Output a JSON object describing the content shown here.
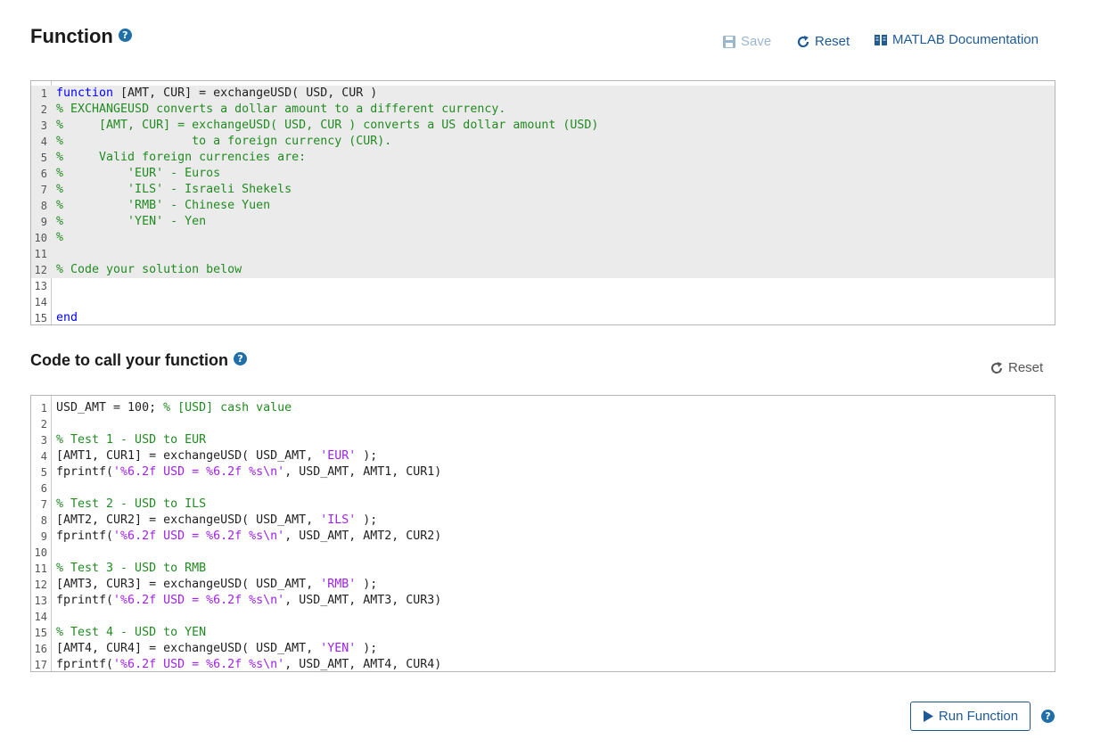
{
  "function_section": {
    "title": "Function",
    "toolbar": {
      "save_label": "Save",
      "reset_label": "Reset",
      "doc_label": "MATLAB Documentation"
    },
    "lines": [
      {
        "n": "1",
        "readonly": true,
        "parts": [
          [
            "kw",
            "function"
          ],
          [
            "tx",
            " [AMT, CUR] = exchangeUSD( USD, CUR )"
          ]
        ]
      },
      {
        "n": "2",
        "readonly": true,
        "parts": [
          [
            "cm",
            "% EXCHANGEUSD converts a dollar amount to a different currency."
          ]
        ]
      },
      {
        "n": "3",
        "readonly": true,
        "parts": [
          [
            "cm",
            "%     [AMT, CUR] = exchangeUSD( USD, CUR ) converts a US dollar amount (USD)"
          ]
        ]
      },
      {
        "n": "4",
        "readonly": true,
        "parts": [
          [
            "cm",
            "%                  to a foreign currency (CUR)."
          ]
        ]
      },
      {
        "n": "5",
        "readonly": true,
        "parts": [
          [
            "cm",
            "%     Valid foreign currencies are:"
          ]
        ]
      },
      {
        "n": "6",
        "readonly": true,
        "parts": [
          [
            "cm",
            "%         'EUR' - Euros"
          ]
        ]
      },
      {
        "n": "7",
        "readonly": true,
        "parts": [
          [
            "cm",
            "%         'ILS' - Israeli Shekels"
          ]
        ]
      },
      {
        "n": "8",
        "readonly": true,
        "parts": [
          [
            "cm",
            "%         'RMB' - Chinese Yuen"
          ]
        ]
      },
      {
        "n": "9",
        "readonly": true,
        "parts": [
          [
            "cm",
            "%         'YEN' - Yen"
          ]
        ]
      },
      {
        "n": "10",
        "readonly": true,
        "parts": [
          [
            "cm",
            "%"
          ]
        ]
      },
      {
        "n": "11",
        "readonly": true,
        "parts": []
      },
      {
        "n": "12",
        "readonly": true,
        "parts": [
          [
            "cm",
            "% Code your solution below"
          ]
        ]
      },
      {
        "n": "13",
        "readonly": false,
        "parts": []
      },
      {
        "n": "14",
        "readonly": false,
        "parts": []
      },
      {
        "n": "15",
        "readonly": false,
        "parts": [
          [
            "kw",
            "end"
          ]
        ]
      }
    ]
  },
  "call_section": {
    "title": "Code to call your function",
    "reset_label": "Reset",
    "lines": [
      {
        "n": "1",
        "parts": [
          [
            "tx",
            "USD_AMT = 100; "
          ],
          [
            "cm",
            "% [USD] cash value"
          ]
        ]
      },
      {
        "n": "2",
        "parts": []
      },
      {
        "n": "3",
        "parts": [
          [
            "cm",
            "% Test 1 - USD to EUR"
          ]
        ]
      },
      {
        "n": "4",
        "parts": [
          [
            "tx",
            "[AMT1, CUR1] = exchangeUSD( USD_AMT, "
          ],
          [
            "st",
            "'EUR'"
          ],
          [
            "tx",
            " );"
          ]
        ]
      },
      {
        "n": "5",
        "parts": [
          [
            "tx",
            "fprintf("
          ],
          [
            "st",
            "'%6.2f USD = %6.2f %s\\n'"
          ],
          [
            "tx",
            ", USD_AMT, AMT1, CUR1)"
          ]
        ]
      },
      {
        "n": "6",
        "parts": []
      },
      {
        "n": "7",
        "parts": [
          [
            "cm",
            "% Test 2 - USD to ILS"
          ]
        ]
      },
      {
        "n": "8",
        "parts": [
          [
            "tx",
            "[AMT2, CUR2] = exchangeUSD( USD_AMT, "
          ],
          [
            "st",
            "'ILS'"
          ],
          [
            "tx",
            " );"
          ]
        ]
      },
      {
        "n": "9",
        "parts": [
          [
            "tx",
            "fprintf("
          ],
          [
            "st",
            "'%6.2f USD = %6.2f %s\\n'"
          ],
          [
            "tx",
            ", USD_AMT, AMT2, CUR2)"
          ]
        ]
      },
      {
        "n": "10",
        "parts": []
      },
      {
        "n": "11",
        "parts": [
          [
            "cm",
            "% Test 3 - USD to RMB"
          ]
        ]
      },
      {
        "n": "12",
        "parts": [
          [
            "tx",
            "[AMT3, CUR3] = exchangeUSD( USD_AMT, "
          ],
          [
            "st",
            "'RMB'"
          ],
          [
            "tx",
            " );"
          ]
        ]
      },
      {
        "n": "13",
        "parts": [
          [
            "tx",
            "fprintf("
          ],
          [
            "st",
            "'%6.2f USD = %6.2f %s\\n'"
          ],
          [
            "tx",
            ", USD_AMT, AMT3, CUR3)"
          ]
        ]
      },
      {
        "n": "14",
        "parts": []
      },
      {
        "n": "15",
        "parts": [
          [
            "cm",
            "% Test 4 - USD to YEN"
          ]
        ]
      },
      {
        "n": "16",
        "parts": [
          [
            "tx",
            "[AMT4, CUR4] = exchangeUSD( USD_AMT, "
          ],
          [
            "st",
            "'YEN'"
          ],
          [
            "tx",
            " );"
          ]
        ]
      },
      {
        "n": "17",
        "parts": [
          [
            "tx",
            "fprintf("
          ],
          [
            "st",
            "'%6.2f USD = %6.2f %s\\n'"
          ],
          [
            "tx",
            ", USD_AMT, AMT4, CUR4)"
          ]
        ]
      }
    ]
  },
  "run": {
    "label": "Run Function"
  },
  "help_glyph": "?",
  "colors": {
    "accent": "#1f5a96",
    "keyword": "#0000ff",
    "comment": "#228b22",
    "string": "#a020f0",
    "readonly_bg": "#ebebeb"
  }
}
